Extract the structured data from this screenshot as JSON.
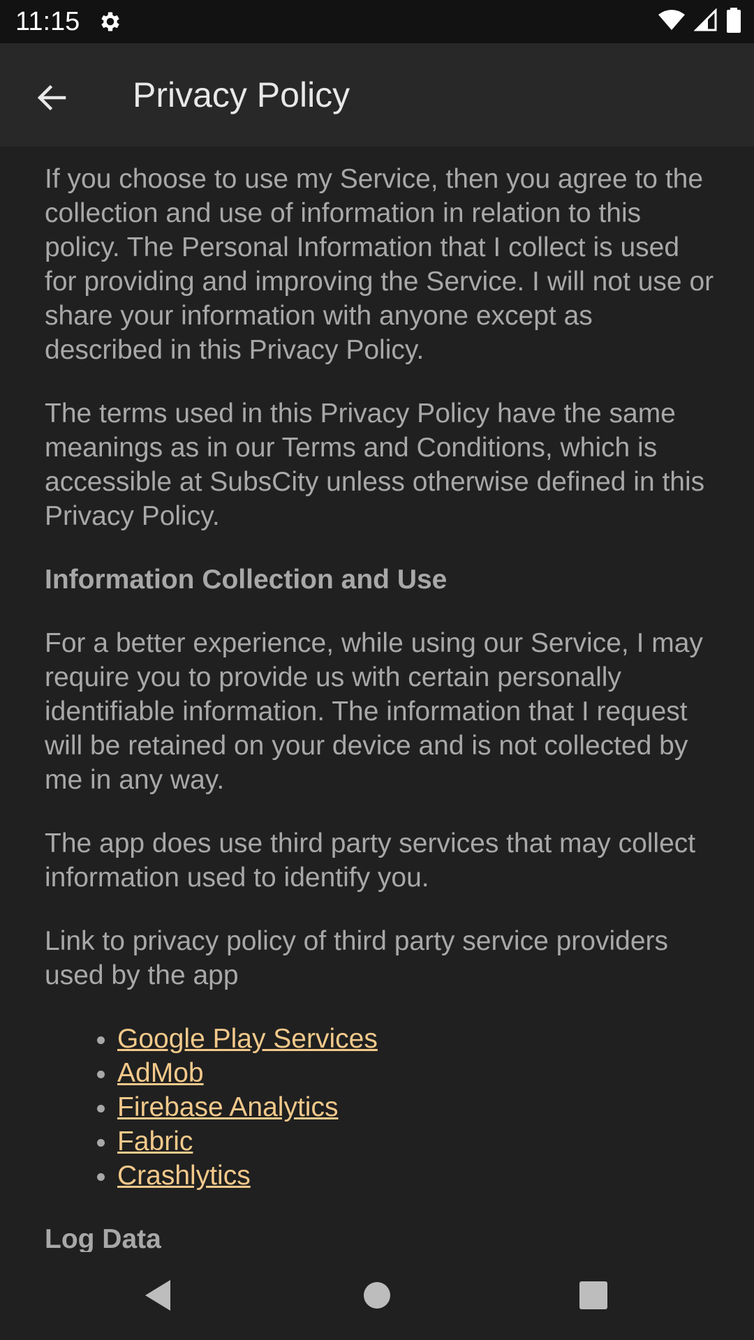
{
  "status_bar": {
    "time": "11:15",
    "icons": [
      "gear-icon",
      "wifi-icon",
      "signal-icon",
      "battery-icon"
    ]
  },
  "app_bar": {
    "title": "Privacy Policy",
    "back_icon": "arrow-back-icon"
  },
  "content": {
    "paragraph_1": "If you choose to use my Service, then you agree to the collection and use of information in relation to this policy. The Personal Information that I collect is used for providing and improving the Service. I will not use or share your information with anyone except as described in this Privacy Policy.",
    "paragraph_2": "The terms used in this Privacy Policy have the same meanings as in our Terms and Conditions, which is accessible at SubsCity unless otherwise defined in this Privacy Policy.",
    "heading_1": "Information Collection and Use",
    "paragraph_3": "For a better experience, while using our Service, I may require you to provide us with certain personally identifiable information. The information that I request will be retained on your device and is not collected by me in any way.",
    "paragraph_4": "The app does use third party services that may collect information used to identify you.",
    "paragraph_5": "Link to privacy policy of third party service providers used by the app",
    "links": [
      "Google Play Services",
      "AdMob",
      "Firebase Analytics",
      "Fabric",
      "Crashlytics"
    ],
    "heading_2": "Log Data"
  },
  "colors": {
    "background": "#202020",
    "app_bar": "#282828",
    "status_bar": "#121212",
    "text": "#a8a8a8",
    "link": "#f3c98b"
  },
  "nav_bar": {
    "icons": [
      "nav-back-icon",
      "nav-home-icon",
      "nav-recents-icon"
    ]
  }
}
